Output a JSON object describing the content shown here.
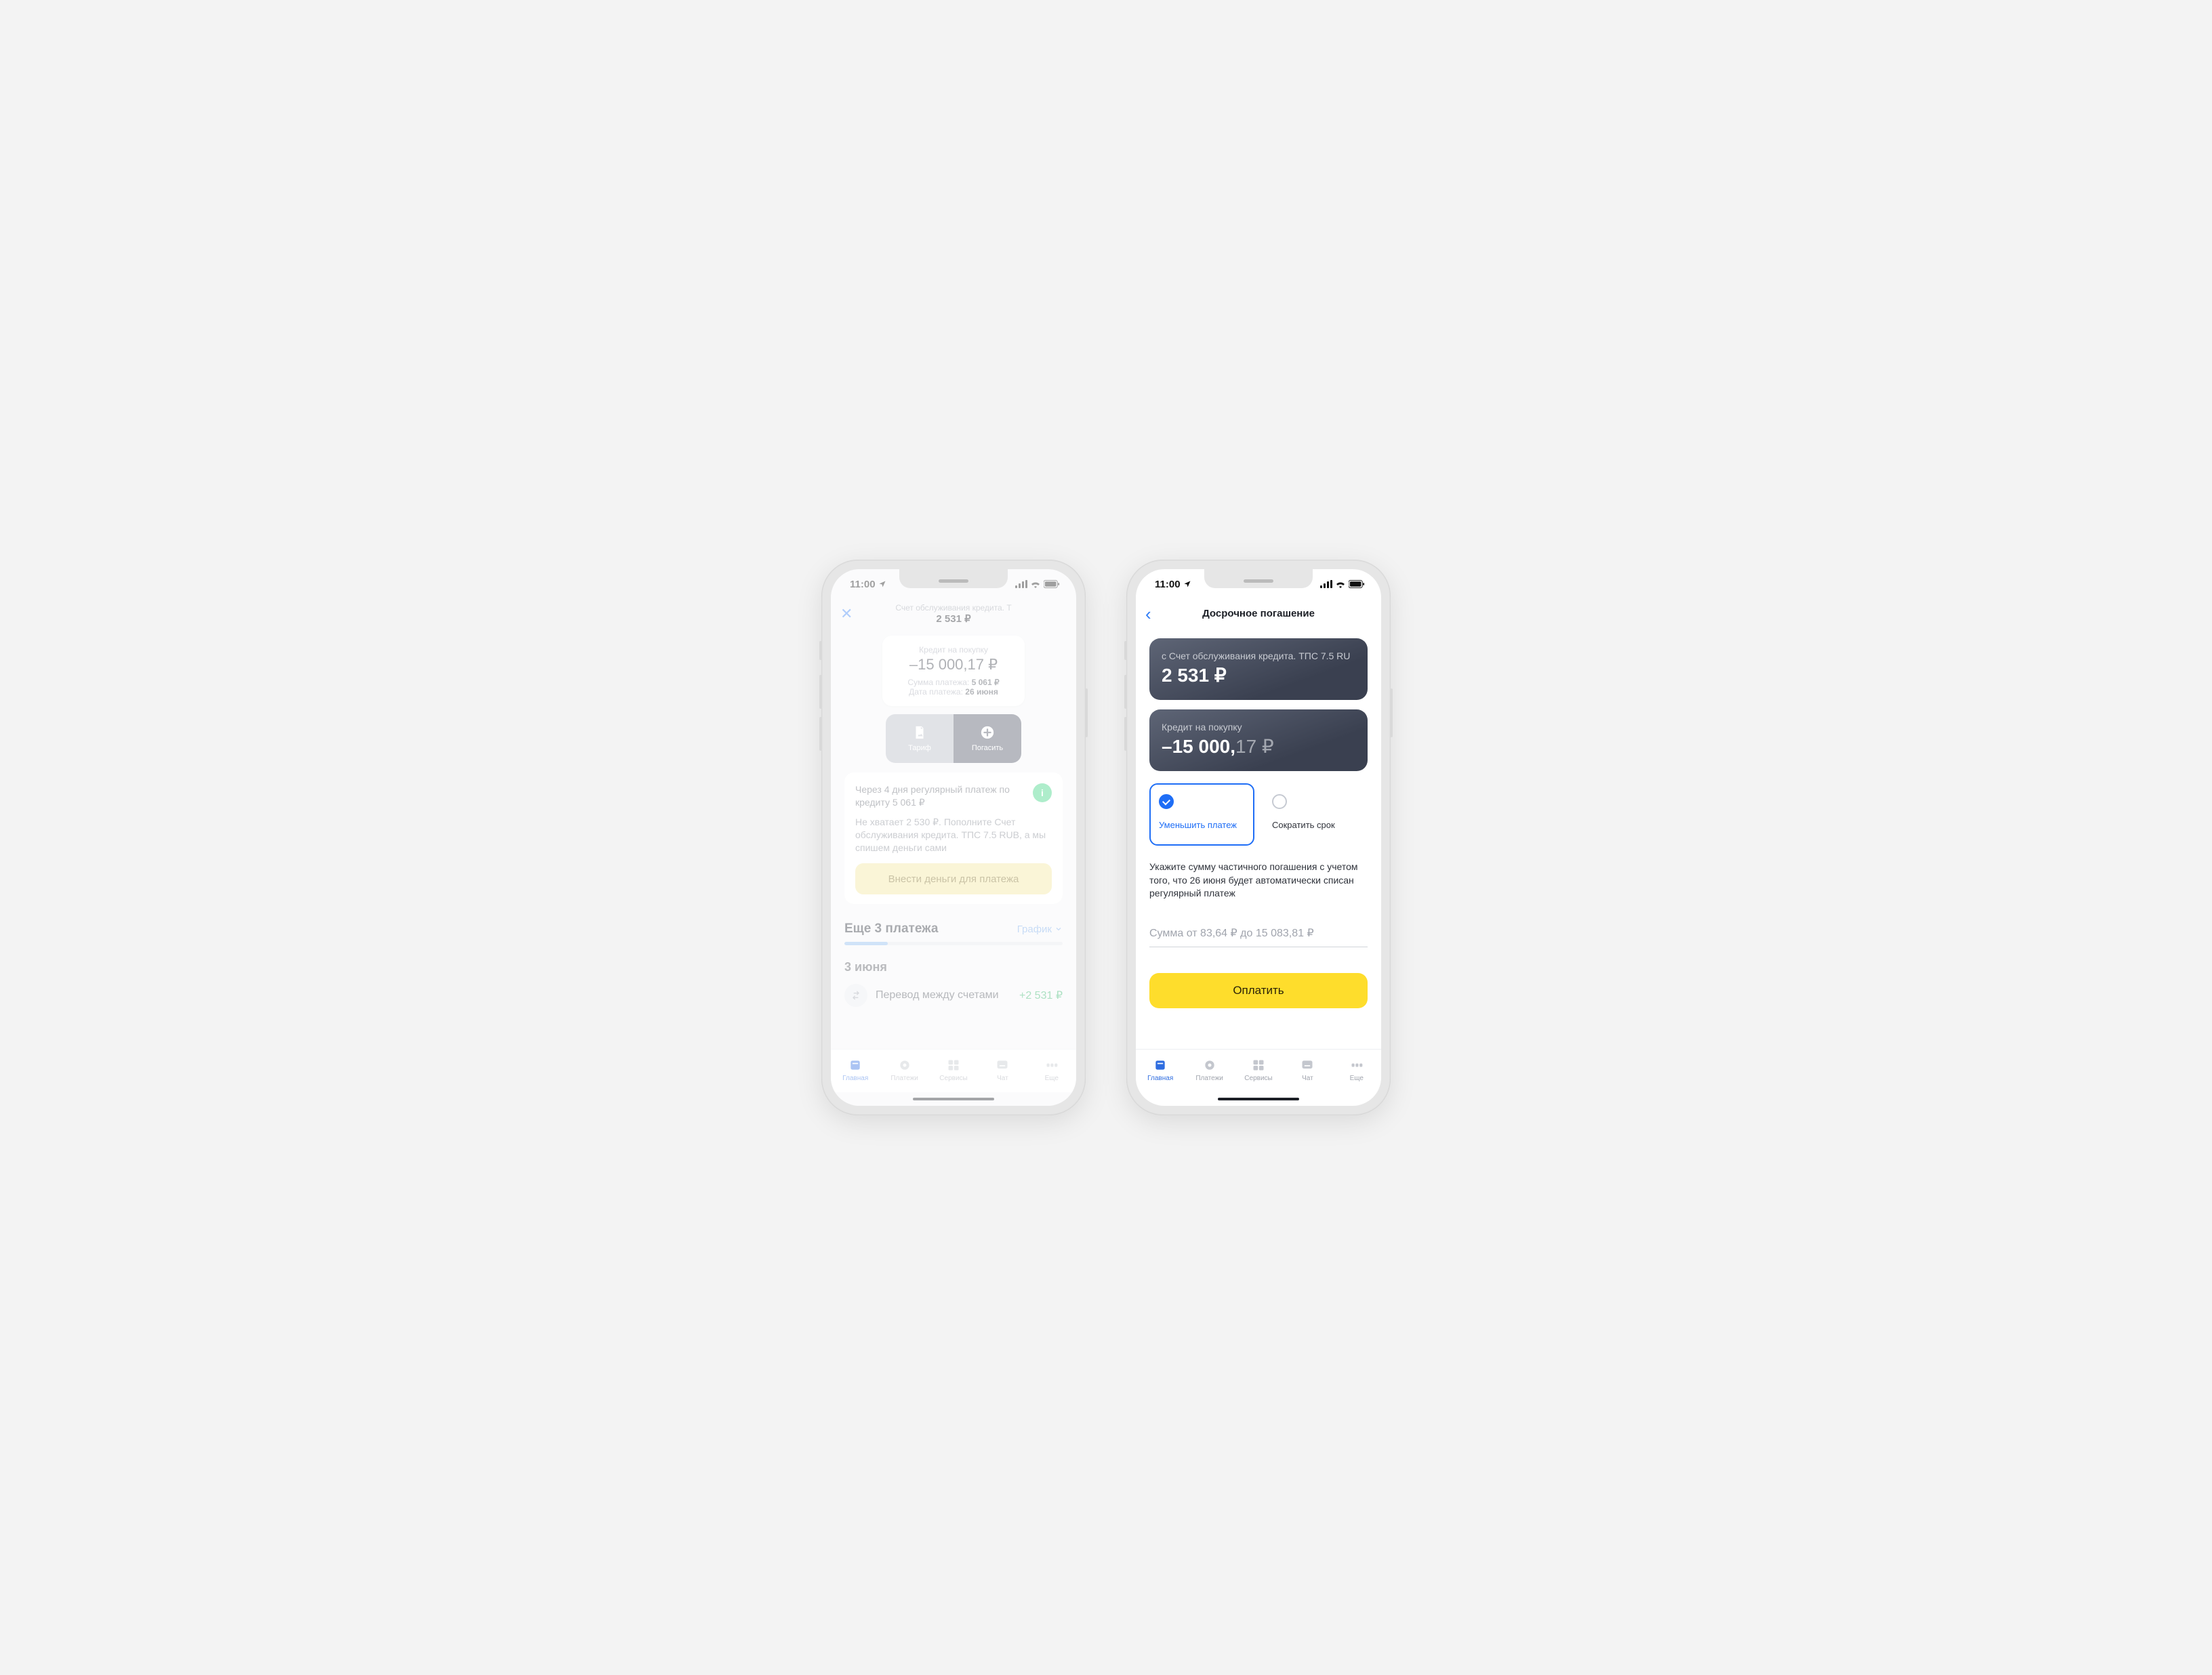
{
  "status": {
    "time": "11:00"
  },
  "left": {
    "nav": {
      "subtitle": "Счет обслуживания кредита. Т",
      "title_amount": "2 531 ₽"
    },
    "loan": {
      "label": "Кредит на покупку",
      "amount": "–15 000,17 ₽",
      "row1_label": "Сумма платежа:",
      "row1_value": "5 061 ₽",
      "row2_label": "Дата платежа:",
      "row2_value": "26 июня"
    },
    "segments": {
      "tariff": "Тариф",
      "repay": "Погасить"
    },
    "notice": {
      "line1": "Через 4 дня регулярный платеж по кредиту 5 061 ₽",
      "line2": "Не хватает 2 530 ₽. Пополните Счет обслуживания кредита. ТПС 7.5 RUB, а мы спишем деньги сами",
      "button": "Внести деньги для платежа"
    },
    "schedule": {
      "title": "Еще 3 платежа",
      "link": "График"
    },
    "date_header": "3 июня",
    "txn": {
      "name": "Перевод между счетами",
      "amount": "+2 531 ₽"
    }
  },
  "right": {
    "nav_title": "Досрочное погашение",
    "from_card": {
      "label": "с Счет обслуживания кредита. ТПС 7.5 RU",
      "amount": "2 531 ₽"
    },
    "loan_card": {
      "label": "Кредит на покупку",
      "amount_int": "–15 000,",
      "amount_cents": "17 ₽"
    },
    "options": {
      "reduce_payment": "Уменьшить платеж",
      "reduce_term": "Сократить срок"
    },
    "hint": "Укажите сумму частичного погашения с учетом того, что 26 июня будет автоматически списан регулярный платеж",
    "input_placeholder": "Сумма от 83,64 ₽ до 15 083,81 ₽",
    "pay_button": "Оплатить"
  },
  "tabs": {
    "home": "Главная",
    "payments": "Платежи",
    "services": "Сервисы",
    "chat": "Чат",
    "more": "Еще"
  }
}
